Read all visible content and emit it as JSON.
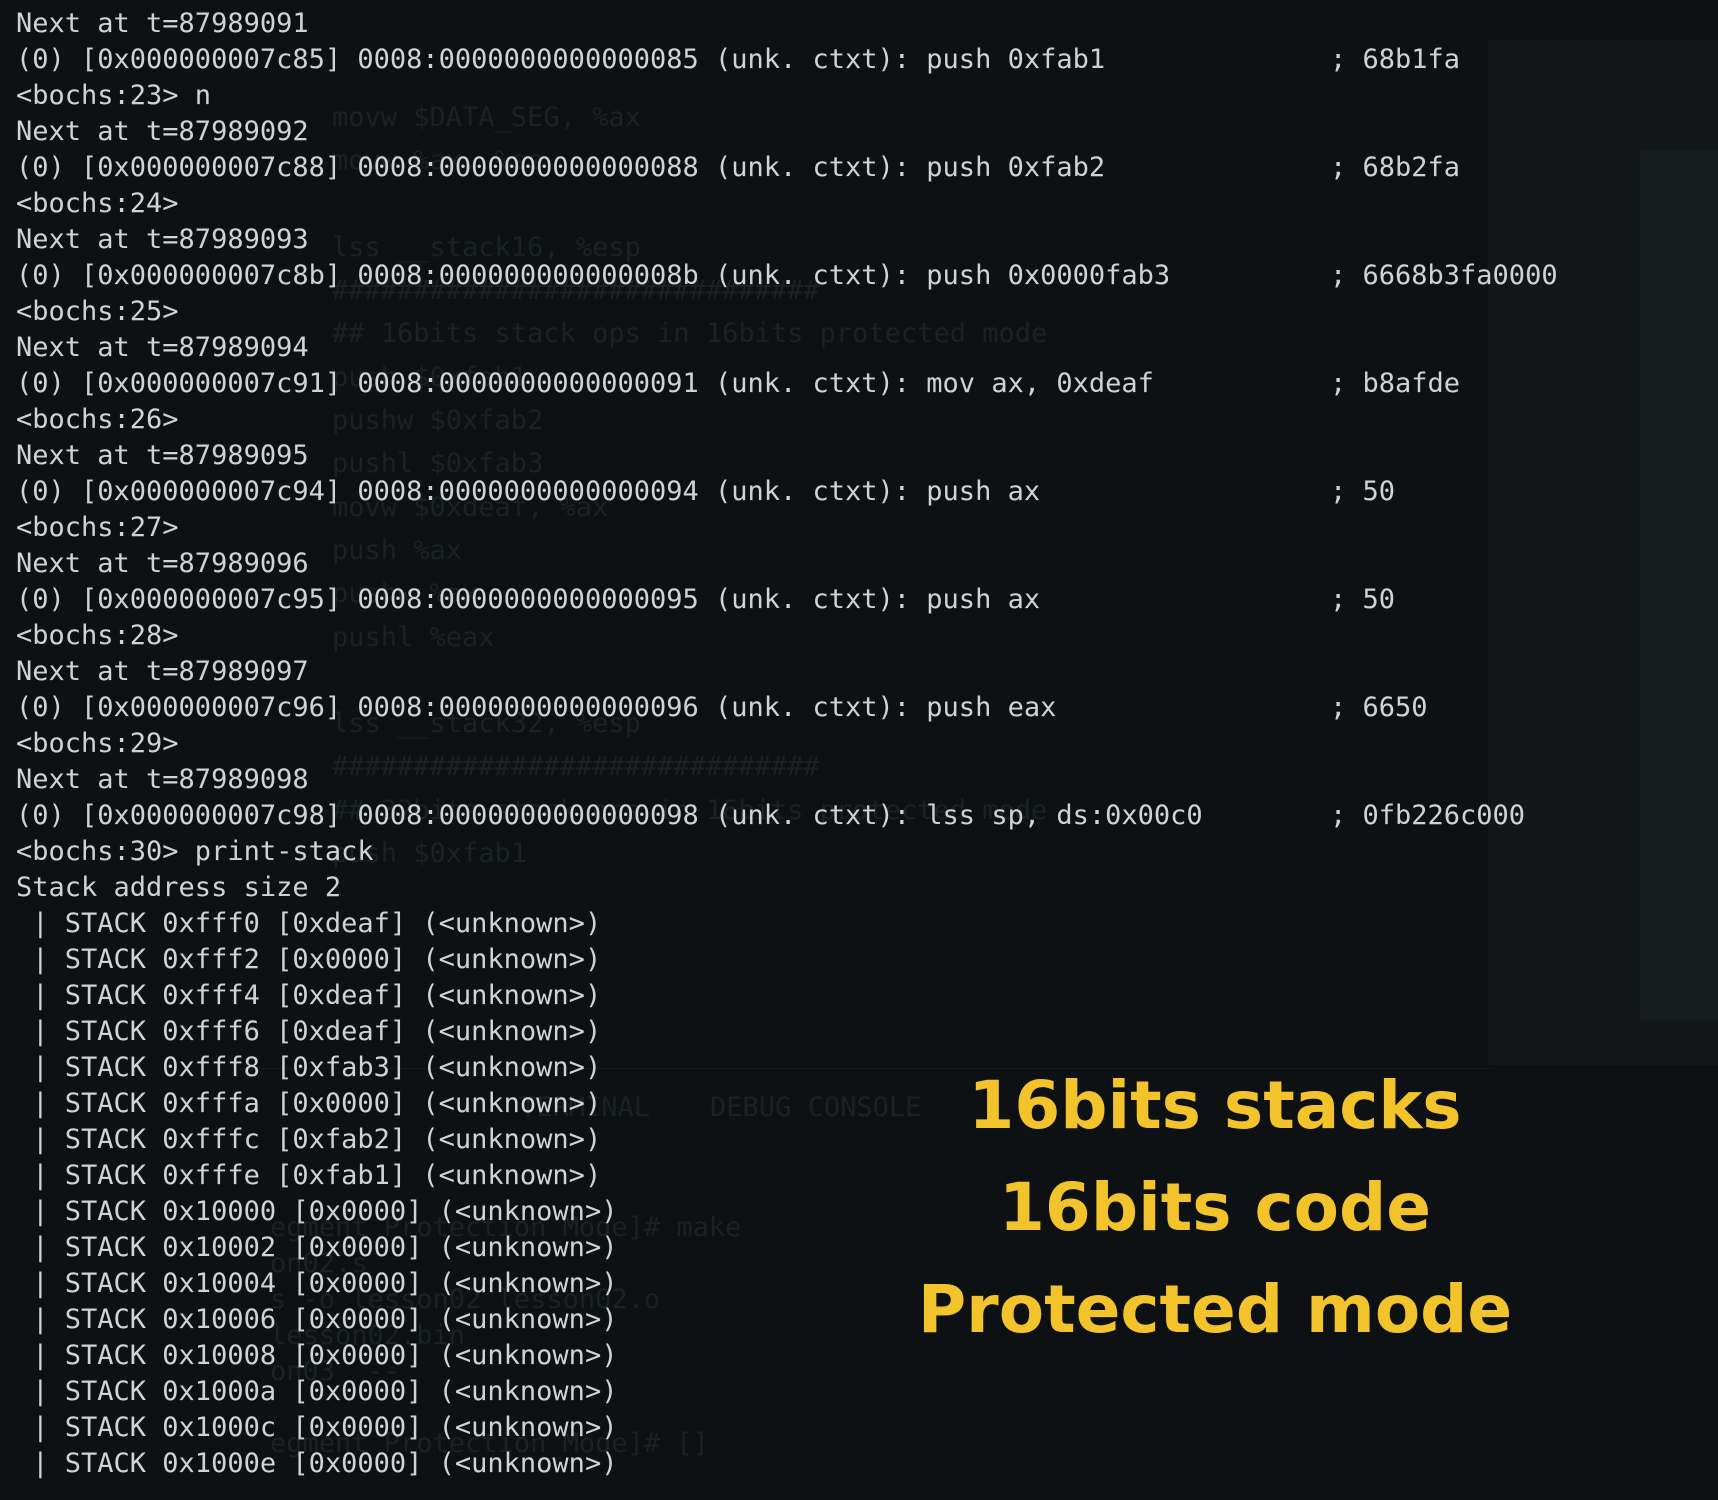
{
  "terminal": {
    "lines": [
      {
        "text": "Next at t=87989091",
        "comment": ""
      },
      {
        "text": "(0) [0x000000007c85] 0008:0000000000000085 (unk. ctxt): push 0xfab1",
        "comment": "; 68b1fa"
      },
      {
        "text": "<bochs:23> n",
        "comment": ""
      },
      {
        "text": "Next at t=87989092",
        "comment": ""
      },
      {
        "text": "(0) [0x000000007c88] 0008:0000000000000088 (unk. ctxt): push 0xfab2",
        "comment": "; 68b2fa"
      },
      {
        "text": "<bochs:24>",
        "comment": ""
      },
      {
        "text": "Next at t=87989093",
        "comment": ""
      },
      {
        "text": "(0) [0x000000007c8b] 0008:000000000000008b (unk. ctxt): push 0x0000fab3",
        "comment": "; 6668b3fa0000"
      },
      {
        "text": "<bochs:25>",
        "comment": ""
      },
      {
        "text": "Next at t=87989094",
        "comment": ""
      },
      {
        "text": "(0) [0x000000007c91] 0008:0000000000000091 (unk. ctxt): mov ax, 0xdeaf",
        "comment": "; b8afde"
      },
      {
        "text": "<bochs:26>",
        "comment": ""
      },
      {
        "text": "Next at t=87989095",
        "comment": ""
      },
      {
        "text": "(0) [0x000000007c94] 0008:0000000000000094 (unk. ctxt): push ax",
        "comment": "; 50"
      },
      {
        "text": "<bochs:27>",
        "comment": ""
      },
      {
        "text": "Next at t=87989096",
        "comment": ""
      },
      {
        "text": "(0) [0x000000007c95] 0008:0000000000000095 (unk. ctxt): push ax",
        "comment": "; 50"
      },
      {
        "text": "<bochs:28>",
        "comment": ""
      },
      {
        "text": "Next at t=87989097",
        "comment": ""
      },
      {
        "text": "(0) [0x000000007c96] 0008:0000000000000096 (unk. ctxt): push eax",
        "comment": "; 6650"
      },
      {
        "text": "<bochs:29>",
        "comment": ""
      },
      {
        "text": "Next at t=87989098",
        "comment": ""
      },
      {
        "text": "(0) [0x000000007c98] 0008:0000000000000098 (unk. ctxt): lss sp, ds:0x00c0",
        "comment": "; 0fb226c000"
      },
      {
        "text": "<bochs:30> print-stack",
        "comment": ""
      },
      {
        "text": "Stack address size 2",
        "comment": ""
      },
      {
        "text": " | STACK 0xfff0 [0xdeaf] (<unknown>)",
        "comment": ""
      },
      {
        "text": " | STACK 0xfff2 [0x0000] (<unknown>)",
        "comment": ""
      },
      {
        "text": " | STACK 0xfff4 [0xdeaf] (<unknown>)",
        "comment": ""
      },
      {
        "text": " | STACK 0xfff6 [0xdeaf] (<unknown>)",
        "comment": ""
      },
      {
        "text": " | STACK 0xfff8 [0xfab3] (<unknown>)",
        "comment": ""
      },
      {
        "text": " | STACK 0xfffa [0x0000] (<unknown>)",
        "comment": ""
      },
      {
        "text": " | STACK 0xfffc [0xfab2] (<unknown>)",
        "comment": ""
      },
      {
        "text": " | STACK 0xfffe [0xfab1] (<unknown>)",
        "comment": ""
      },
      {
        "text": " | STACK 0x10000 [0x0000] (<unknown>)",
        "comment": ""
      },
      {
        "text": " | STACK 0x10002 [0x0000] (<unknown>)",
        "comment": ""
      },
      {
        "text": " | STACK 0x10004 [0x0000] (<unknown>)",
        "comment": ""
      },
      {
        "text": " | STACK 0x10006 [0x0000] (<unknown>)",
        "comment": ""
      },
      {
        "text": " | STACK 0x10008 [0x0000] (<unknown>)",
        "comment": ""
      },
      {
        "text": " | STACK 0x1000a [0x0000] (<unknown>)",
        "comment": ""
      },
      {
        "text": " | STACK 0x1000c [0x0000] (<unknown>)",
        "comment": ""
      },
      {
        "text": " | STACK 0x1000e [0x0000] (<unknown>)",
        "comment": ""
      }
    ]
  },
  "background_editor": {
    "code_lines": [
      "movw $DATA_SEG, %ax",
      "movw %ax, %ss",
      "",
      "lss __stack16, %esp",
      "##############################",
      "## 16bits stack ops in 16bits protected mode",
      "push $0xfab1",
      "pushw $0xfab2",
      "pushl $0xfab3",
      "movw $0xdeaf, %ax",
      "push %ax",
      "pushw %ax",
      "pushl %eax",
      "",
      "lss __stack32, %esp",
      "##############################",
      "## 32bits stack ops in 16bits protected mode",
      "push $0xfab1"
    ],
    "panel_tabs": [
      "TERMINAL",
      "DEBUG CONSOLE"
    ],
    "terminal_lines": [
      "egment_Protection_Mode]# make",
      "on02.s",
      "s -o lesson02 lesson02.o",
      "lesson02.bin",
      "on03  --",
      "",
      "egment_Protection_Mode]# []"
    ]
  },
  "overlay": {
    "captions": [
      "16bits stacks",
      "16bits code",
      "Protected mode"
    ],
    "color": "#f3c32b"
  },
  "colors": {
    "background": "#0d1113",
    "text": "#cfd3d6"
  }
}
